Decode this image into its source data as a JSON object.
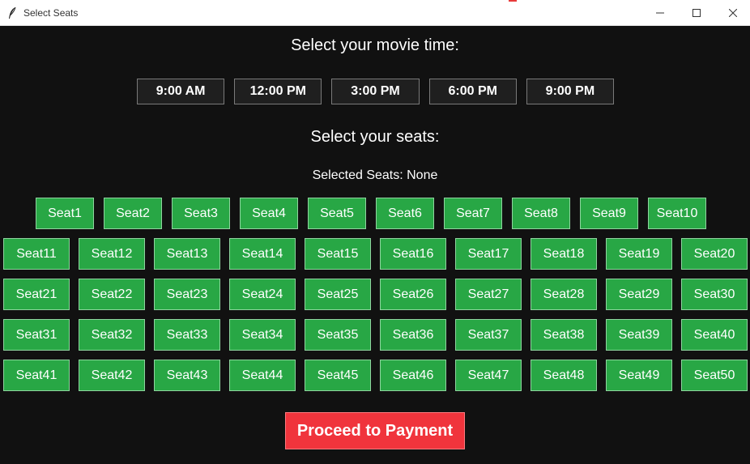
{
  "window": {
    "title": "Select Seats"
  },
  "headings": {
    "movie_time": "Select your movie time:",
    "seats": "Select your seats:"
  },
  "times": [
    "9:00 AM",
    "12:00 PM",
    "3:00 PM",
    "6:00 PM",
    "9:00 PM"
  ],
  "selected_seats": {
    "text": "Selected Seats: None"
  },
  "seats": [
    [
      "Seat1",
      "Seat2",
      "Seat3",
      "Seat4",
      "Seat5",
      "Seat6",
      "Seat7",
      "Seat8",
      "Seat9",
      "Seat10"
    ],
    [
      "Seat11",
      "Seat12",
      "Seat13",
      "Seat14",
      "Seat15",
      "Seat16",
      "Seat17",
      "Seat18",
      "Seat19",
      "Seat20"
    ],
    [
      "Seat21",
      "Seat22",
      "Seat23",
      "Seat24",
      "Seat25",
      "Seat26",
      "Seat27",
      "Seat28",
      "Seat29",
      "Seat30"
    ],
    [
      "Seat31",
      "Seat32",
      "Seat33",
      "Seat34",
      "Seat35",
      "Seat36",
      "Seat37",
      "Seat38",
      "Seat39",
      "Seat40"
    ],
    [
      "Seat41",
      "Seat42",
      "Seat43",
      "Seat44",
      "Seat45",
      "Seat46",
      "Seat47",
      "Seat48",
      "Seat49",
      "Seat50"
    ]
  ],
  "actions": {
    "proceed_label": "Proceed to Payment"
  },
  "icons": {
    "app": "feather-icon",
    "minimize": "minimize-icon",
    "maximize": "maximize-icon",
    "close": "close-icon"
  },
  "colors": {
    "background": "#111111",
    "seat_available": "#28a745",
    "proceed_button": "#f0343c",
    "time_button": "#1f1f1f"
  }
}
